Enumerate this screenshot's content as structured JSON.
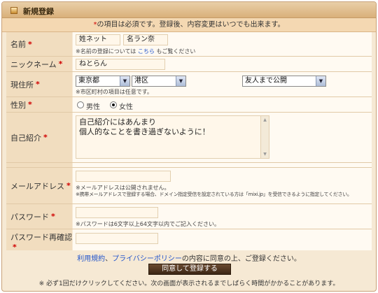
{
  "header": {
    "title": "新規登録"
  },
  "notice": {
    "required_mark": "*",
    "text": "の項目は必須です。登録後、内容変更はいつでも出来ます。"
  },
  "required_mark": "*",
  "form": {
    "name": {
      "label": "名前",
      "last_name": "姓ネット",
      "first_name": "名ラン奈",
      "note_prefix": "※名前の登録については",
      "note_link": "こちら",
      "note_suffix": "もご覧ください"
    },
    "nickname": {
      "label": "ニックネーム",
      "value": "ねとらん"
    },
    "address": {
      "label": "現住所",
      "prefecture": "東京都",
      "city": "港区",
      "visibility": "友人まで公開",
      "note": "※市区町村の項目は任意です。"
    },
    "gender": {
      "label": "性別",
      "options": [
        {
          "label": "男性",
          "selected": false
        },
        {
          "label": "女性",
          "selected": true
        }
      ]
    },
    "intro": {
      "label": "自己紹介",
      "lines": [
        "自己紹介にはあんまり",
        "個人的なことを書き過ぎないように！"
      ]
    },
    "email": {
      "label": "メールアドレス",
      "value": "",
      "note1": "※メールアドレスは公開されません。",
      "note2": "※携帯メールアドレスで登録する場合、ドメイン指定受信を設定されている方は「mixi.jp」を受信できるように指定してください。"
    },
    "password": {
      "label": "パスワード",
      "value": "",
      "note": "※パスワードは6文字以上64文字以内でご記入ください。"
    },
    "password_confirm": {
      "label": "パスワード再確認",
      "value": ""
    }
  },
  "terms": {
    "link1": "利用規約",
    "sep": "、",
    "link2": "プライバシーポリシー",
    "suffix": "の内容に同意の上、ご登録ください。"
  },
  "submit_label": "同意して登録する",
  "footer_note": "※ 必ず1回だけクリックしてください。次の画面が表示されるまでしばらく時間がかかることがあります。"
}
